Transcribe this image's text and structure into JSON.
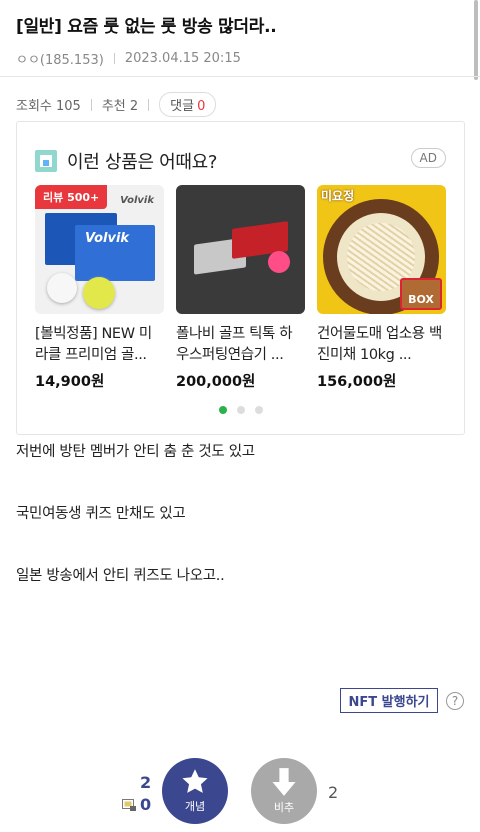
{
  "post": {
    "title": "[일반] 요즘 룻 없는 룻 방송 많더라..",
    "author": "ㅇㅇ(185.153)",
    "date": "2023.04.15 20:15"
  },
  "stats": {
    "views_label": "조회수 105",
    "recommend_label": "추천 2",
    "comments_label": "댓글",
    "comments_count": "0"
  },
  "ad": {
    "title": "이런 상품은 어때요?",
    "badge": "AD",
    "products": [
      {
        "name": "[볼빅정품] NEW 미라클 프리미엄 골...",
        "price": "14,900원",
        "tag": "리뷰 500+",
        "brand": "Volvik"
      },
      {
        "name": "폴나비 골프 틱톡 하우스퍼팅연습기 ...",
        "price": "200,000원"
      },
      {
        "name": "건어물도매 업소용 백진미채 10kg ...",
        "price": "156,000원",
        "brand": "미요정",
        "box": "BOX"
      }
    ]
  },
  "body": {
    "lines": [
      "저번에 방탄 멤버가 안티 춤 춘 것도 있고",
      "국민여동생 퀴즈 만채도 있고",
      "일본 방송에서 안티 퀴즈도 나오고.."
    ]
  },
  "actions": {
    "nft_label": "NFT 발행하기",
    "help": "?",
    "vote_up_count": "2",
    "fixed_count": "0",
    "vote_up_label": "개념",
    "vote_down_label": "비추",
    "vote_down_count": "2"
  },
  "colors": {
    "accent": "#3b4890",
    "red": "#e8383d",
    "dot_active": "#2bb24c"
  }
}
